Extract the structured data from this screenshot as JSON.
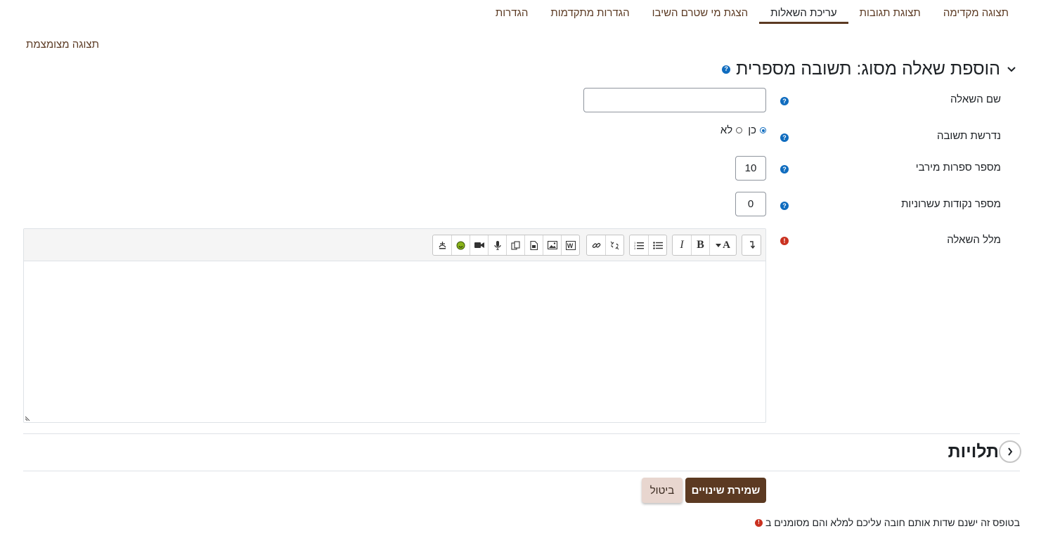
{
  "tabs": [
    {
      "label": "תצוגה מקדימה",
      "active": false
    },
    {
      "label": "תצוגת תגובות",
      "active": false
    },
    {
      "label": "עריכת השאלות",
      "active": true
    },
    {
      "label": "הצגת מי שטרם השיבו",
      "active": false
    },
    {
      "label": "הגדרות מתקדמות",
      "active": false
    },
    {
      "label": "הגדרות",
      "active": false
    }
  ],
  "collapse_all": "תצוגה מצומצמת",
  "section": {
    "title": "הוספת שאלה מסוג: תשובה מספרית"
  },
  "fields": {
    "question_name": {
      "label": "שם השאלה",
      "value": ""
    },
    "required": {
      "label": "נדרשת תשובה",
      "yes": "כן",
      "no": "לא",
      "selected": "yes"
    },
    "max_digits": {
      "label": "מספר ספרות מירבי",
      "value": "10"
    },
    "decimal_places": {
      "label": "מספר נקודות עשרוניות",
      "value": "0"
    },
    "question_text": {
      "label": "מלל השאלה",
      "value": ""
    }
  },
  "toolbar_icons": [
    "show-more-buttons-icon",
    "font-style-icon",
    "bold-icon",
    "italic-icon",
    "unordered-list-icon",
    "ordered-list-icon",
    "link-icon",
    "unlink-icon",
    "wiris-formula-icon",
    "image-icon",
    "file-embed-icon",
    "copy-icon",
    "record-audio-icon",
    "record-video-icon",
    "emoji-icon",
    "accessibility-checker-icon"
  ],
  "dependencies_section": {
    "title": "תלויות"
  },
  "buttons": {
    "save": "שמירת שינויים",
    "cancel": "ביטול"
  },
  "footnote": "בטופס זה ישנם שדות אותם חובה עליכם למלא והם מסומנים ב",
  "colors": {
    "accent": "#5c3a22",
    "help": "#0f6cbf",
    "required": "#ca3120",
    "cancel_bg": "#e8d6cf"
  }
}
